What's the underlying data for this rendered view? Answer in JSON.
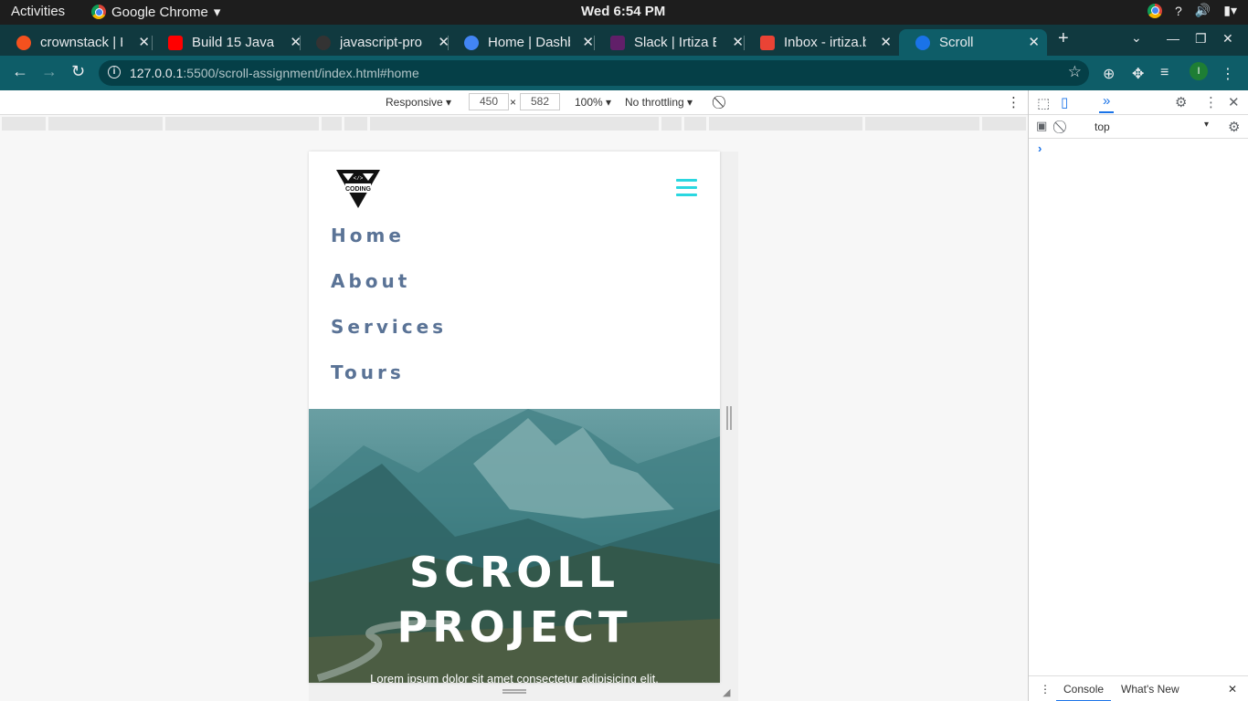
{
  "system_bar": {
    "activities": "Activities",
    "app_name": "Google Chrome",
    "clock": "Wed  6:54 PM"
  },
  "tabs": [
    {
      "title": "crownstack | H",
      "icon": "crownstack-icon",
      "color": "#f4511e"
    },
    {
      "title": "Build 15 JavaS",
      "icon": "youtube-icon",
      "color": "#ff0000"
    },
    {
      "title": "javascript-pro",
      "icon": "github-icon",
      "color": "#333333"
    },
    {
      "title": "Home | Dashb",
      "icon": "k-icon",
      "color": "#4285f4"
    },
    {
      "title": "Slack | Irtiza Ba",
      "icon": "slack-icon",
      "color": "#611f69"
    },
    {
      "title": "Inbox - irtiza.b",
      "icon": "gmail-icon",
      "color": "#ea4335"
    },
    {
      "title": "Scroll",
      "icon": "globe-icon",
      "color": "#1a73e8"
    }
  ],
  "address_bar": {
    "host": "127.0.0.1",
    "path": ":5500/scroll-assignment/index.html#home"
  },
  "profile_initial": "I",
  "device_toolbar": {
    "device": "Responsive",
    "width": "450",
    "height": "582",
    "zoom": "100%",
    "throttling": "No throttling"
  },
  "site": {
    "logo_text": "CODING",
    "nav_links": [
      "Home",
      "About",
      "Services",
      "Tours"
    ],
    "hero_title_line1": "SCROLL",
    "hero_title_line2": "PROJECT",
    "hero_lead": "Lorem ipsum dolor sit amet consectetur adipisicing elit.",
    "accent_color": "#2ad7e0"
  },
  "devtools": {
    "context": "top",
    "tab_console": "Console",
    "tab_whatsnew": "What's New"
  }
}
